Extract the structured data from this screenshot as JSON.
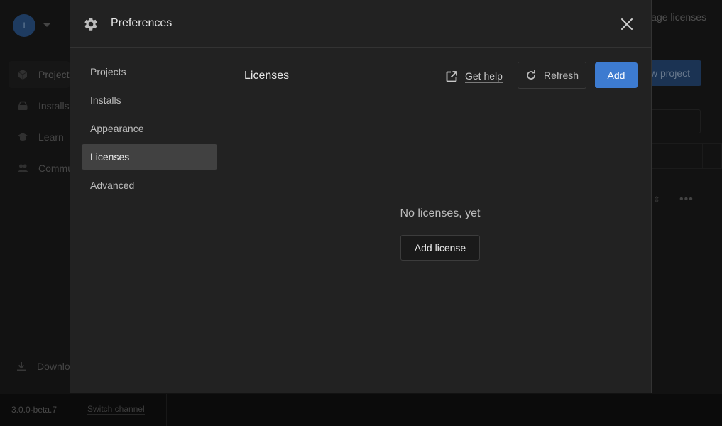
{
  "background": {
    "avatar_initial": "I",
    "nav_items": [
      {
        "label": "Projects",
        "icon": "cube-icon",
        "active": true
      },
      {
        "label": "Installs",
        "icon": "drive-icon",
        "active": false
      },
      {
        "label": "Learn",
        "icon": "graduation-cap-icon",
        "active": false
      },
      {
        "label": "Community",
        "icon": "people-icon",
        "active": false
      }
    ],
    "download_label": "Downloads",
    "manage_licenses_label": "Manage licenses",
    "new_project_label": "New project",
    "version": "3.0.0-beta.7",
    "switch_channel_label": "Switch channel"
  },
  "dialog": {
    "title": "Preferences",
    "title_icon": "gear-icon",
    "close_icon": "close-icon",
    "sidebar": [
      {
        "label": "Projects",
        "active": false
      },
      {
        "label": "Installs",
        "active": false
      },
      {
        "label": "Appearance",
        "active": false
      },
      {
        "label": "Licenses",
        "active": true
      },
      {
        "label": "Advanced",
        "active": false
      }
    ],
    "content": {
      "title": "Licenses",
      "get_help_label": "Get help",
      "refresh_label": "Refresh",
      "add_label": "Add",
      "empty_message": "No licenses, yet",
      "add_license_label": "Add license"
    }
  },
  "colors": {
    "accent": "#3d7bd0",
    "dialog_bg": "#222222",
    "active_item_bg": "#414141"
  }
}
